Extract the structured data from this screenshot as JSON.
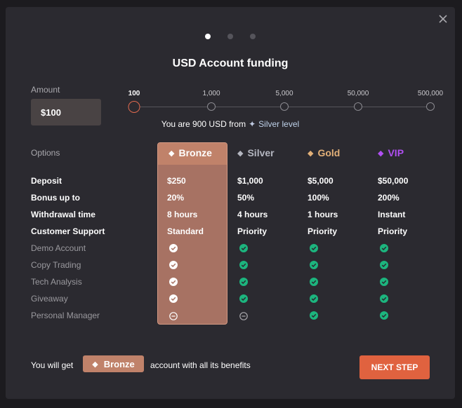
{
  "modal": {
    "title": "USD Account funding",
    "steps": {
      "total": 3,
      "current": 1
    }
  },
  "amount": {
    "label": "Amount",
    "value": "$100"
  },
  "slider": {
    "ticks": [
      "100",
      "1,000",
      "5,000",
      "50,000",
      "500,000"
    ],
    "selected_index": 0
  },
  "level_message": {
    "prefix": "You are 900 USD from",
    "icon": "sparkle-icon",
    "level": "Silver level"
  },
  "options_label": "Options",
  "tiers": [
    {
      "name": "Bronze",
      "color": "#ffffff",
      "icon": "diamond-icon"
    },
    {
      "name": "Silver",
      "color": "#b4b6c0",
      "icon": "diamond-icon"
    },
    {
      "name": "Gold",
      "color": "#e2b078",
      "icon": "diamond-icon"
    },
    {
      "name": "VIP",
      "color": "#b04ff2",
      "icon": "diamond-icon"
    }
  ],
  "value_rows": [
    {
      "label": "Deposit",
      "values": [
        "$250",
        "$1,000",
        "$5,000",
        "$50,000"
      ]
    },
    {
      "label": "Bonus up to",
      "values": [
        "20%",
        "50%",
        "100%",
        "200%"
      ]
    },
    {
      "label": "Withdrawal time",
      "values": [
        "8 hours",
        "4 hours",
        "1 hours",
        "Instant"
      ]
    },
    {
      "label": "Customer Support",
      "values": [
        "Standard",
        "Priority",
        "Priority",
        "Priority"
      ]
    }
  ],
  "feature_rows": [
    {
      "label": "Demo Account",
      "available": [
        true,
        true,
        true,
        true
      ]
    },
    {
      "label": "Copy Trading",
      "available": [
        true,
        true,
        true,
        true
      ]
    },
    {
      "label": "Tech Analysis",
      "available": [
        true,
        true,
        true,
        true
      ]
    },
    {
      "label": "Giveaway",
      "available": [
        true,
        true,
        true,
        true
      ]
    },
    {
      "label": "Personal Manager",
      "available": [
        false,
        false,
        true,
        true
      ]
    }
  ],
  "footer": {
    "prefix": "You will get",
    "tier": "Bronze",
    "suffix": "account with all its benefits",
    "button": "NEXT STEP"
  },
  "colors": {
    "accent": "#e0623f",
    "check": "#1cb57e",
    "bronze": "#c0826a"
  }
}
